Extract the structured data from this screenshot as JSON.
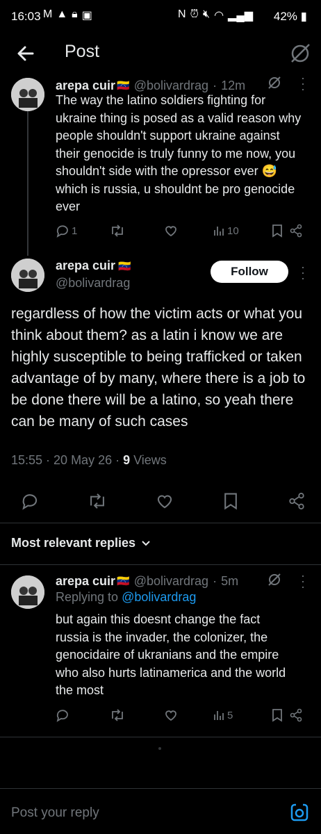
{
  "status_bar": {
    "time": "16:03",
    "battery": "42%"
  },
  "header": {
    "title": "Post"
  },
  "parent_post": {
    "display_name": "arepa cuir",
    "flag": "🇻🇪",
    "handle": "@bolivardrag",
    "time": "12m",
    "text": "The way the latino soldiers fighting for ukraine thing is posed as a valid reason why people shouldn't support ukraine against their genocide is truly funny to me now, you shouldn't side with the opressor ever 😅 which is russia, u shouldnt be pro genocide ever",
    "reply_count": "1",
    "view_count": "10"
  },
  "main_post": {
    "display_name": "arepa cuir",
    "flag": "🇻🇪",
    "handle": "@bolivardrag",
    "follow_label": "Follow",
    "text": "regardless of how the victim acts or what you think about them? as a latin i know we are highly susceptible to being trafficked or taken advantage of by many, where there is a job to be done there will be a latino, so yeah there can be many of such cases",
    "timestamp": "15:55 · 20 May 26 · ",
    "views_count": "9",
    "views_label": " Views"
  },
  "replies_section": {
    "label": "Most relevant replies"
  },
  "reply_post": {
    "display_name": "arepa cuir",
    "flag": "🇻🇪",
    "handle": "@bolivardrag",
    "time": "5m",
    "replying_to_label": "Replying to ",
    "replying_to_handle": "@bolivardrag",
    "text": "but again this doesnt change the fact russia is the invader, the colonizer, the genocidaire of ukranians and the empire who also hurts latinamerica and the world the most",
    "view_count": "5"
  },
  "composer": {
    "placeholder": "Post your reply"
  },
  "colors": {
    "background": "#000000",
    "text": "#e7e9ea",
    "muted": "#71767b",
    "link": "#1d9bf0",
    "divider": "#2f3336"
  },
  "icons": [
    "back-arrow-icon",
    "grok-icon",
    "reply-icon",
    "retweet-icon",
    "like-icon",
    "views-icon",
    "bookmark-icon",
    "share-icon",
    "more-icon",
    "camera-icon"
  ]
}
